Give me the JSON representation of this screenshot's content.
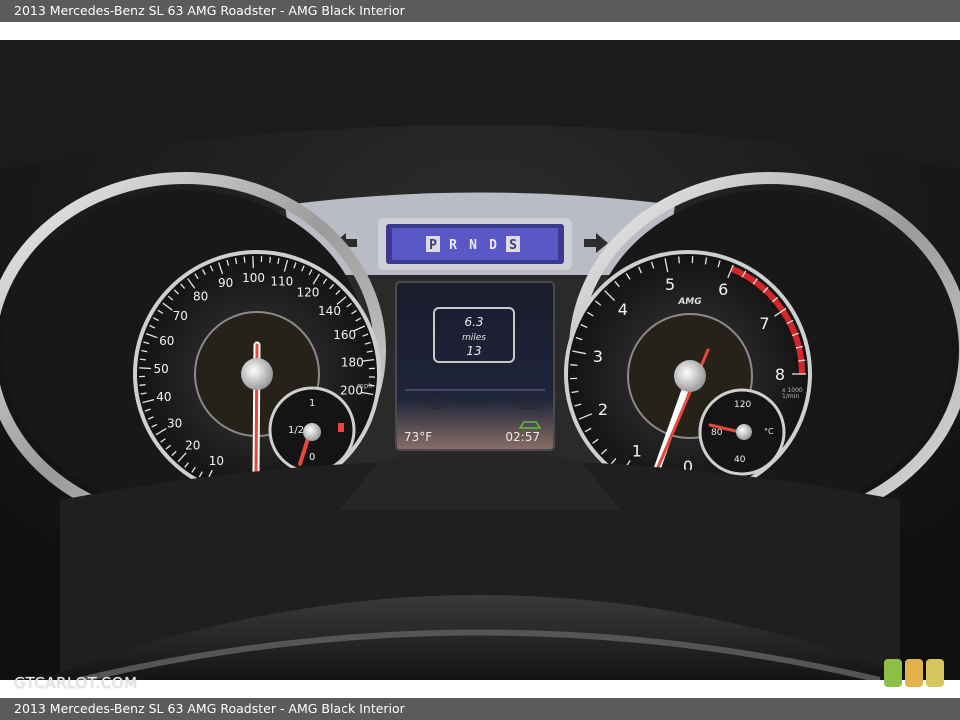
{
  "title_top": "2013 Mercedes-Benz SL 63 AMG Roadster - AMG Black Interior",
  "title_bottom": "2013 Mercedes-Benz SL 63 AMG Roadster - AMG Black Interior",
  "watermark": "GTCARLOT.COM",
  "cluster": {
    "gear_selector": [
      "P",
      "R",
      "N",
      "D",
      "S"
    ],
    "speedometer": {
      "ticks": [
        "10",
        "20",
        "30",
        "40",
        "50",
        "60",
        "70",
        "80",
        "90",
        "100",
        "110",
        "120",
        "140",
        "160",
        "180",
        "200"
      ],
      "unit": "mph",
      "needle_value": 0
    },
    "fuel_gauge": {
      "labels": [
        "1/2",
        "1",
        "0"
      ]
    },
    "tachometer": {
      "ticks": [
        "0",
        "1",
        "2",
        "3",
        "4",
        "5",
        "6",
        "7",
        "8"
      ],
      "unit_line1": "x 1000",
      "unit_line2": "1/min",
      "brand": "AMG"
    },
    "temp_gauge": {
      "labels": [
        "120",
        "80",
        "40",
        "°C"
      ]
    },
    "display": {
      "trip_distance": "6.3",
      "trip_unit": "miles",
      "trip_count": "13",
      "outside_temp": "73°F",
      "clock": "02:57"
    }
  },
  "colors": {
    "needle": "#e8473b",
    "redline": "#d8252a",
    "display_purple": "#5a57c6"
  },
  "badge_colors": [
    "#8dbf46",
    "#e2b24a",
    "#d6c65b"
  ]
}
